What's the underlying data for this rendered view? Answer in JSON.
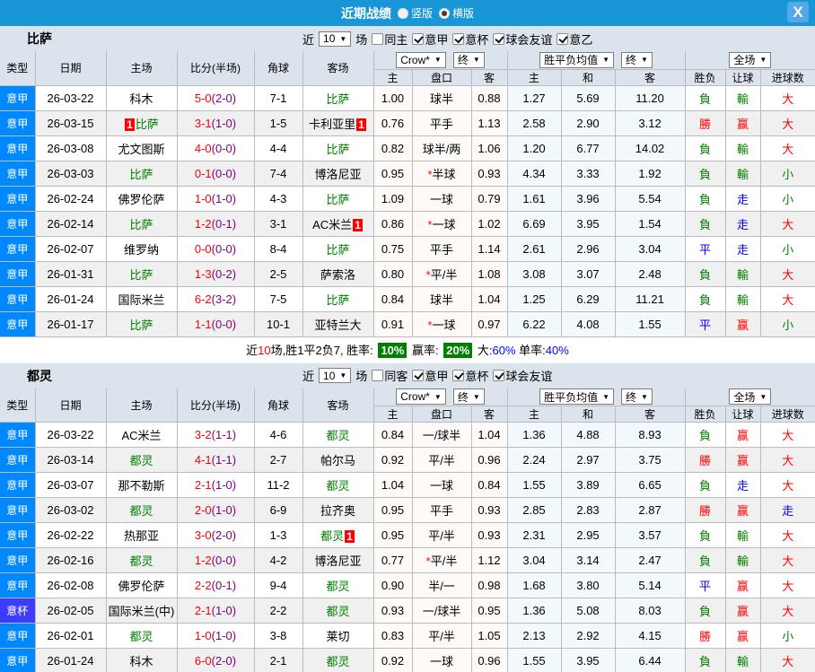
{
  "titlebar": {
    "title": "近期战绩",
    "radios": [
      {
        "label": "竖版",
        "checked": false,
        "name": "radio-vertical"
      },
      {
        "label": "横版",
        "checked": true,
        "name": "radio-horizontal"
      }
    ],
    "close": "X"
  },
  "table_header": {
    "left_cols": [
      "类型",
      "日期",
      "主场",
      "比分(半场)",
      "角球",
      "客场"
    ],
    "groups": [
      {
        "selects": [
          {
            "label": "Crow*",
            "name": "odds-source-select"
          },
          {
            "label": "终",
            "name": "final-select-1"
          }
        ]
      },
      {
        "selects": [
          {
            "label": "胜平负均值",
            "name": "wdl-mean-select"
          },
          {
            "label": "终",
            "name": "final-select-2"
          }
        ]
      },
      {
        "selects": [
          {
            "label": "全场",
            "name": "full-match-select"
          }
        ]
      }
    ],
    "sub_cols": [
      "主",
      "盘口",
      "客",
      "主",
      "和",
      "客",
      "胜负",
      "让球",
      "进球数"
    ]
  },
  "colors": {
    "league": {
      "意甲": "#0088ff",
      "意杯": "#3c3cff"
    },
    "result": {
      "勝": "#ff0000",
      "赢": "#ff0000",
      "大": "#ff0000",
      "負": "#008000",
      "輸": "#008000",
      "小": "#008000",
      "平": "#0000ff",
      "走": "#0000ff"
    },
    "team_highlight": "#008000",
    "score_ft": "#ff0000",
    "score_ht": "#000080"
  },
  "sections": [
    {
      "team": "比萨",
      "filter": {
        "near": "近",
        "count": "10",
        "unit": "场",
        "same": {
          "label": "同主",
          "checked": false
        },
        "leagues": [
          {
            "label": "意甲",
            "checked": true
          },
          {
            "label": "意杯",
            "checked": true
          },
          {
            "label": "球会友谊",
            "checked": true
          },
          {
            "label": "意乙",
            "checked": true
          }
        ]
      },
      "rows": [
        {
          "lg": "意甲",
          "date": "26-03-22",
          "home": "科木",
          "hfocus": false,
          "hbadge": "",
          "ft": "5-0",
          "ht": "(2-0)",
          "ck": "7-1",
          "away": "比萨",
          "afocus": true,
          "abadge": "",
          "o1": "1.00",
          "hc": "球半",
          "star": false,
          "o2": "0.88",
          "w": "1.27",
          "d": "5.69",
          "l": "11.20",
          "r1": "負",
          "r2": "輸",
          "r3": "大"
        },
        {
          "lg": "意甲",
          "date": "26-03-15",
          "home": "比萨",
          "hfocus": true,
          "hbadge": "1",
          "ft": "3-1",
          "ht": "(1-0)",
          "ck": "1-5",
          "away": "卡利亚里",
          "afocus": false,
          "abadge": "1",
          "o1": "0.76",
          "hc": "平手",
          "star": false,
          "o2": "1.13",
          "w": "2.58",
          "d": "2.90",
          "l": "3.12",
          "r1": "勝",
          "r2": "赢",
          "r3": "大"
        },
        {
          "lg": "意甲",
          "date": "26-03-08",
          "home": "尤文图斯",
          "hfocus": false,
          "hbadge": "",
          "ft": "4-0",
          "ht": "(0-0)",
          "ck": "4-4",
          "away": "比萨",
          "afocus": true,
          "abadge": "",
          "o1": "0.82",
          "hc": "球半/两",
          "star": false,
          "o2": "1.06",
          "w": "1.20",
          "d": "6.77",
          "l": "14.02",
          "r1": "負",
          "r2": "輸",
          "r3": "大"
        },
        {
          "lg": "意甲",
          "date": "26-03-03",
          "home": "比萨",
          "hfocus": true,
          "hbadge": "",
          "ft": "0-1",
          "ht": "(0-0)",
          "ck": "7-4",
          "away": "博洛尼亚",
          "afocus": false,
          "abadge": "",
          "o1": "0.95",
          "hc": "半球",
          "star": true,
          "o2": "0.93",
          "w": "4.34",
          "d": "3.33",
          "l": "1.92",
          "r1": "負",
          "r2": "輸",
          "r3": "小"
        },
        {
          "lg": "意甲",
          "date": "26-02-24",
          "home": "佛罗伦萨",
          "hfocus": false,
          "hbadge": "",
          "ft": "1-0",
          "ht": "(1-0)",
          "ck": "4-3",
          "away": "比萨",
          "afocus": true,
          "abadge": "",
          "o1": "1.09",
          "hc": "一球",
          "star": false,
          "o2": "0.79",
          "w": "1.61",
          "d": "3.96",
          "l": "5.54",
          "r1": "負",
          "r2": "走",
          "r3": "小"
        },
        {
          "lg": "意甲",
          "date": "26-02-14",
          "home": "比萨",
          "hfocus": true,
          "hbadge": "",
          "ft": "1-2",
          "ht": "(0-1)",
          "ck": "3-1",
          "away": "AC米兰",
          "afocus": false,
          "abadge": "1",
          "o1": "0.86",
          "hc": "一球",
          "star": true,
          "o2": "1.02",
          "w": "6.69",
          "d": "3.95",
          "l": "1.54",
          "r1": "負",
          "r2": "走",
          "r3": "大"
        },
        {
          "lg": "意甲",
          "date": "26-02-07",
          "home": "维罗纳",
          "hfocus": false,
          "hbadge": "",
          "ft": "0-0",
          "ht": "(0-0)",
          "ck": "8-4",
          "away": "比萨",
          "afocus": true,
          "abadge": "",
          "o1": "0.75",
          "hc": "平手",
          "star": false,
          "o2": "1.14",
          "w": "2.61",
          "d": "2.96",
          "l": "3.04",
          "r1": "平",
          "r2": "走",
          "r3": "小"
        },
        {
          "lg": "意甲",
          "date": "26-01-31",
          "home": "比萨",
          "hfocus": true,
          "hbadge": "",
          "ft": "1-3",
          "ht": "(0-2)",
          "ck": "2-5",
          "away": "萨索洛",
          "afocus": false,
          "abadge": "",
          "o1": "0.80",
          "hc": "平/半",
          "star": true,
          "o2": "1.08",
          "w": "3.08",
          "d": "3.07",
          "l": "2.48",
          "r1": "負",
          "r2": "輸",
          "r3": "大"
        },
        {
          "lg": "意甲",
          "date": "26-01-24",
          "home": "国际米兰",
          "hfocus": false,
          "hbadge": "",
          "ft": "6-2",
          "ht": "(3-2)",
          "ck": "7-5",
          "away": "比萨",
          "afocus": true,
          "abadge": "",
          "o1": "0.84",
          "hc": "球半",
          "star": false,
          "o2": "1.04",
          "w": "1.25",
          "d": "6.29",
          "l": "11.21",
          "r1": "負",
          "r2": "輸",
          "r3": "大"
        },
        {
          "lg": "意甲",
          "date": "26-01-17",
          "home": "比萨",
          "hfocus": true,
          "hbadge": "",
          "ft": "1-1",
          "ht": "(0-0)",
          "ck": "10-1",
          "away": "亚特兰大",
          "afocus": false,
          "abadge": "",
          "o1": "0.91",
          "hc": "一球",
          "star": true,
          "o2": "0.97",
          "w": "6.22",
          "d": "4.08",
          "l": "1.55",
          "r1": "平",
          "r2": "赢",
          "r3": "小"
        }
      ],
      "summary": [
        {
          "t": "近",
          "c": "#000000"
        },
        {
          "t": "10",
          "c": "#ff0000"
        },
        {
          "t": "场,胜1平2负7, 胜率: ",
          "c": "#000000"
        },
        {
          "t": "10%",
          "badge": true
        },
        {
          "t": " 赢率: ",
          "c": "#000000"
        },
        {
          "t": "20%",
          "badge": true
        },
        {
          "t": " 大:",
          "c": "#000000"
        },
        {
          "t": "60%",
          "c": "#0000ff"
        },
        {
          "t": " 单率:",
          "c": "#000000"
        },
        {
          "t": "40%",
          "c": "#0000ff"
        }
      ]
    },
    {
      "team": "都灵",
      "filter": {
        "near": "近",
        "count": "10",
        "unit": "场",
        "same": {
          "label": "同客",
          "checked": false
        },
        "leagues": [
          {
            "label": "意甲",
            "checked": true
          },
          {
            "label": "意杯",
            "checked": true
          },
          {
            "label": "球会友谊",
            "checked": true
          }
        ]
      },
      "rows": [
        {
          "lg": "意甲",
          "date": "26-03-22",
          "home": "AC米兰",
          "hfocus": false,
          "hbadge": "",
          "ft": "3-2",
          "ht": "(1-1)",
          "ck": "4-6",
          "away": "都灵",
          "afocus": true,
          "abadge": "",
          "o1": "0.84",
          "hc": "一/球半",
          "star": false,
          "o2": "1.04",
          "w": "1.36",
          "d": "4.88",
          "l": "8.93",
          "r1": "負",
          "r2": "赢",
          "r3": "大"
        },
        {
          "lg": "意甲",
          "date": "26-03-14",
          "home": "都灵",
          "hfocus": true,
          "hbadge": "",
          "ft": "4-1",
          "ht": "(1-1)",
          "ck": "2-7",
          "away": "帕尔马",
          "afocus": false,
          "abadge": "",
          "o1": "0.92",
          "hc": "平/半",
          "star": false,
          "o2": "0.96",
          "w": "2.24",
          "d": "2.97",
          "l": "3.75",
          "r1": "勝",
          "r2": "赢",
          "r3": "大"
        },
        {
          "lg": "意甲",
          "date": "26-03-07",
          "home": "那不勒斯",
          "hfocus": false,
          "hbadge": "",
          "ft": "2-1",
          "ht": "(1-0)",
          "ck": "11-2",
          "away": "都灵",
          "afocus": true,
          "abadge": "",
          "o1": "1.04",
          "hc": "一球",
          "star": false,
          "o2": "0.84",
          "w": "1.55",
          "d": "3.89",
          "l": "6.65",
          "r1": "負",
          "r2": "走",
          "r3": "大"
        },
        {
          "lg": "意甲",
          "date": "26-03-02",
          "home": "都灵",
          "hfocus": true,
          "hbadge": "",
          "ft": "2-0",
          "ht": "(1-0)",
          "ck": "6-9",
          "away": "拉齐奥",
          "afocus": false,
          "abadge": "",
          "o1": "0.95",
          "hc": "平手",
          "star": false,
          "o2": "0.93",
          "w": "2.85",
          "d": "2.83",
          "l": "2.87",
          "r1": "勝",
          "r2": "赢",
          "r3": "走"
        },
        {
          "lg": "意甲",
          "date": "26-02-22",
          "home": "热那亚",
          "hfocus": false,
          "hbadge": "",
          "ft": "3-0",
          "ht": "(2-0)",
          "ck": "1-3",
          "away": "都灵",
          "afocus": true,
          "abadge": "1",
          "o1": "0.95",
          "hc": "平/半",
          "star": false,
          "o2": "0.93",
          "w": "2.31",
          "d": "2.95",
          "l": "3.57",
          "r1": "負",
          "r2": "輸",
          "r3": "大"
        },
        {
          "lg": "意甲",
          "date": "26-02-16",
          "home": "都灵",
          "hfocus": true,
          "hbadge": "",
          "ft": "1-2",
          "ht": "(0-0)",
          "ck": "4-2",
          "away": "博洛尼亚",
          "afocus": false,
          "abadge": "",
          "o1": "0.77",
          "hc": "平/半",
          "star": true,
          "o2": "1.12",
          "w": "3.04",
          "d": "3.14",
          "l": "2.47",
          "r1": "負",
          "r2": "輸",
          "r3": "大"
        },
        {
          "lg": "意甲",
          "date": "26-02-08",
          "home": "佛罗伦萨",
          "hfocus": false,
          "hbadge": "",
          "ft": "2-2",
          "ht": "(0-1)",
          "ck": "9-4",
          "away": "都灵",
          "afocus": true,
          "abadge": "",
          "o1": "0.90",
          "hc": "半/一",
          "star": false,
          "o2": "0.98",
          "w": "1.68",
          "d": "3.80",
          "l": "5.14",
          "r1": "平",
          "r2": "赢",
          "r3": "大"
        },
        {
          "lg": "意杯",
          "date": "26-02-05",
          "home": "国际米兰(中)",
          "hfocus": false,
          "hbadge": "",
          "ft": "2-1",
          "ht": "(1-0)",
          "ck": "2-2",
          "away": "都灵",
          "afocus": true,
          "abadge": "",
          "o1": "0.93",
          "hc": "一/球半",
          "star": false,
          "o2": "0.95",
          "w": "1.36",
          "d": "5.08",
          "l": "8.03",
          "r1": "負",
          "r2": "赢",
          "r3": "大"
        },
        {
          "lg": "意甲",
          "date": "26-02-01",
          "home": "都灵",
          "hfocus": true,
          "hbadge": "",
          "ft": "1-0",
          "ht": "(1-0)",
          "ck": "3-8",
          "away": "莱切",
          "afocus": false,
          "abadge": "",
          "o1": "0.83",
          "hc": "平/半",
          "star": false,
          "o2": "1.05",
          "w": "2.13",
          "d": "2.92",
          "l": "4.15",
          "r1": "勝",
          "r2": "赢",
          "r3": "小"
        },
        {
          "lg": "意甲",
          "date": "26-01-24",
          "home": "科木",
          "hfocus": false,
          "hbadge": "",
          "ft": "6-0",
          "ht": "(2-0)",
          "ck": "2-1",
          "away": "都灵",
          "afocus": true,
          "abadge": "",
          "o1": "0.92",
          "hc": "一球",
          "star": false,
          "o2": "0.96",
          "w": "1.55",
          "d": "3.95",
          "l": "6.44",
          "r1": "負",
          "r2": "輸",
          "r3": "大"
        }
      ]
    }
  ]
}
